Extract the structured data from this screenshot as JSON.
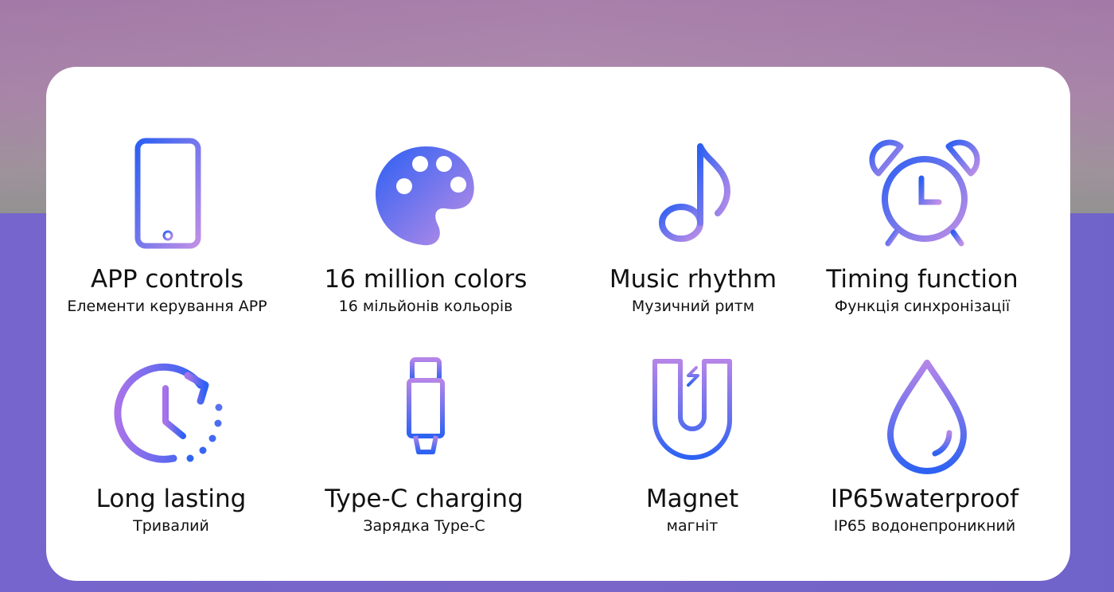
{
  "features": [
    {
      "title": "APP controls",
      "subtitle": "Елементи керування APP",
      "icon": "smartphone-icon"
    },
    {
      "title": "16 million colors",
      "subtitle": "16 мільйонів кольорів",
      "icon": "palette-icon"
    },
    {
      "title": "Music rhythm",
      "subtitle": "Музичний ритм",
      "icon": "music-note-icon"
    },
    {
      "title": "Timing function",
      "subtitle": "Функція синхронізації",
      "icon": "alarm-clock-icon"
    },
    {
      "title": "Long lasting",
      "subtitle": "Тривалий",
      "icon": "clock-refresh-icon"
    },
    {
      "title": "Type-C charging",
      "subtitle": "Зарядка Type-C",
      "icon": "type-c-cable-icon"
    },
    {
      "title": "Magnet",
      "subtitle": "магніт",
      "icon": "magnet-icon"
    },
    {
      "title": "IP65waterproof",
      "subtitle": "IP65 водонепроникний",
      "icon": "water-drop-icon"
    }
  ],
  "colors": {
    "gradient_start": "#2f63f2",
    "gradient_end": "#b68be6",
    "text": "#111111"
  }
}
